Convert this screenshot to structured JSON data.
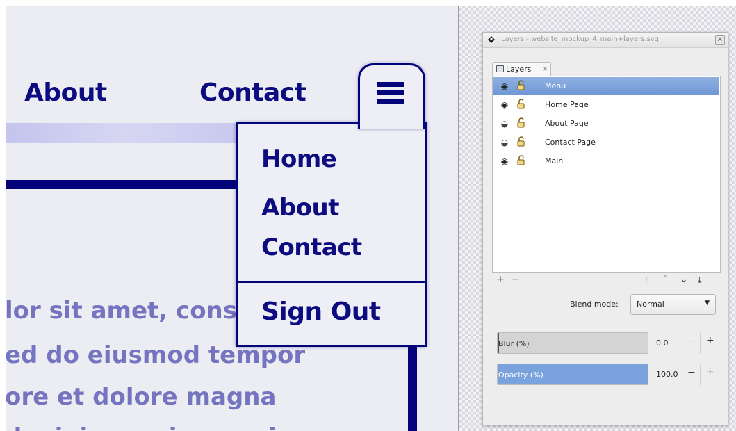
{
  "mockup": {
    "nav": {
      "about": "About",
      "contact": "Contact"
    },
    "dropdown": {
      "home": "Home",
      "about": "About",
      "contact": "Contact",
      "sign_out": "Sign Out"
    },
    "lorem_lines": [
      "lor sit amet, consectetur",
      "ed do eiusmod tempor",
      "ore et dolore magna",
      "d minim veniam, quis"
    ],
    "colors": {
      "navy": "#04047a",
      "text": "#0c0c80",
      "lorem": "#7474c0"
    }
  },
  "dialog": {
    "title": "Layers - website_mockup_4_main+layers.svg",
    "close_glyph": "✕",
    "tab": {
      "label": "Layers",
      "close": "×"
    },
    "layers": [
      {
        "name": "Menu",
        "visible": true,
        "selected": true
      },
      {
        "name": "Home Page",
        "visible": true,
        "selected": false
      },
      {
        "name": "About Page",
        "visible": false,
        "selected": false
      },
      {
        "name": "Contact Page",
        "visible": false,
        "selected": false
      },
      {
        "name": "Main",
        "visible": true,
        "selected": false
      }
    ],
    "toolbar": {
      "add": "+",
      "remove": "−",
      "top": "⤒",
      "up": "⌃",
      "down": "⌄",
      "bottom": "⤓"
    },
    "blend": {
      "label": "Blend mode:",
      "value": "Normal"
    },
    "blur": {
      "label": "Blur (%)",
      "value": "0.0",
      "minus": "−",
      "plus": "+"
    },
    "opacity": {
      "label": "Opacity (%)",
      "value": "100.0",
      "minus": "−",
      "plus": "+"
    }
  }
}
